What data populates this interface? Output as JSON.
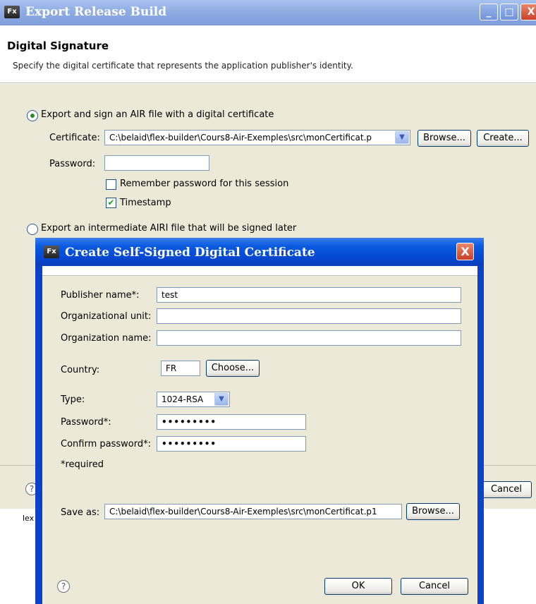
{
  "main_window": {
    "icon_text": "Fx",
    "title": "Export Release Build",
    "title_buttons": {
      "minimize": "_",
      "maximize": "□",
      "close": "X"
    },
    "banner": {
      "title": "Digital Signature",
      "description": "Specify the digital certificate that represents the application publisher's identity."
    },
    "export_sign": {
      "label": "Export and sign an AIR file with a digital certificate",
      "selected": true,
      "certificate_label": "Certificate:",
      "certificate_value": "C:\\belaid\\flex-builder\\Cours8-Air-Exemples\\src\\monCertificat.p",
      "browse_label": "Browse...",
      "create_label": "Create...",
      "password_label": "Password:",
      "password_value": "",
      "remember_label": "Remember password for this session",
      "remember_checked": false,
      "timestamp_label": "Timestamp",
      "timestamp_checked": true
    },
    "export_intermediate": {
      "label": "Export an intermediate AIRI file that will be signed later",
      "selected": false
    },
    "footer": {
      "help": "?",
      "cancel_label": "Cancel"
    },
    "status_fragment": "lex Pro"
  },
  "dialog": {
    "icon_text": "Fx",
    "title": "Create Self-Signed Digital Certificate",
    "close_glyph": "X",
    "publisher_label": "Publisher name*:",
    "publisher_value": "test",
    "org_unit_label": "Organizational unit:",
    "org_unit_value": "",
    "org_name_label": "Organization name:",
    "org_name_value": "",
    "country_label": "Country:",
    "country_value": "FR",
    "choose_label": "Choose...",
    "type_label": "Type:",
    "type_value": "1024-RSA",
    "password_label": "Password*:",
    "password_value": "•••••••••",
    "confirm_label": "Confirm password*:",
    "confirm_value": "•••••••••",
    "required_note": "*required",
    "save_as_label": "Save as:",
    "save_as_value": "C:\\belaid\\flex-builder\\Cours8-Air-Exemples\\src\\monCertificat.p1",
    "browse_label": "Browse...",
    "help": "?",
    "ok_label": "OK",
    "cancel_label": "Cancel"
  },
  "colors": {
    "xp_title_blue": "#0548d2",
    "dialog_bg": "#ece9d8",
    "close_red": "#c9402a"
  },
  "icons": [
    "fx-app-icon",
    "help-icon",
    "combo-arrow-icon",
    "close-icon",
    "check-icon"
  ]
}
